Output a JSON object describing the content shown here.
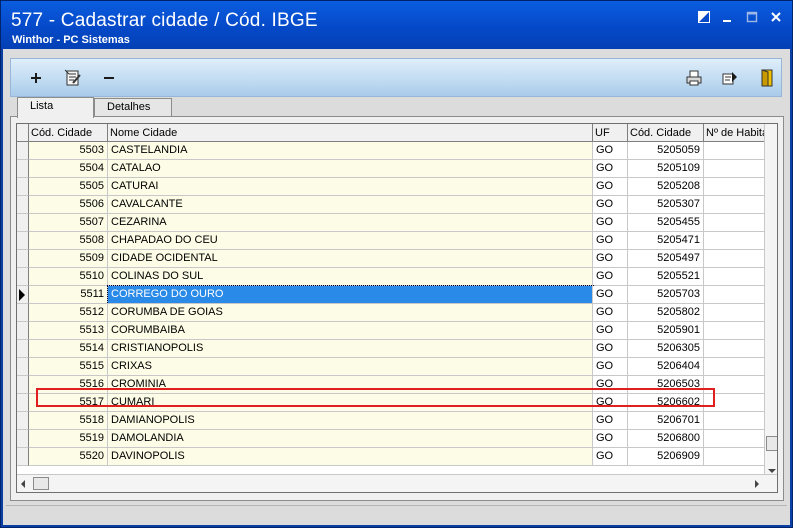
{
  "window": {
    "title": "577 - Cadastrar cidade / Cód. IBGE",
    "subtitle": "Winthor - PC Sistemas"
  },
  "toolbar": {
    "left_buttons": [
      "add-icon",
      "edit-document-icon",
      "remove-icon"
    ],
    "right_buttons": [
      "print-icon",
      "export-icon",
      "exit-icon"
    ]
  },
  "tabs": [
    {
      "label": "Lista",
      "active": true
    },
    {
      "label": "Detalhes",
      "active": false
    }
  ],
  "grid": {
    "columns": [
      "Cód. Cidade",
      "Nome Cidade",
      "UF",
      "Cód. Cidade",
      "Nº de Habita"
    ],
    "rows": [
      {
        "cod": "5503",
        "nome": "CASTELANDIA",
        "uf": "GO",
        "ibge": "5205059"
      },
      {
        "cod": "5504",
        "nome": "CATALAO",
        "uf": "GO",
        "ibge": "5205109"
      },
      {
        "cod": "5505",
        "nome": "CATURAI",
        "uf": "GO",
        "ibge": "5205208"
      },
      {
        "cod": "5506",
        "nome": "CAVALCANTE",
        "uf": "GO",
        "ibge": "5205307"
      },
      {
        "cod": "5507",
        "nome": "CEZARINA",
        "uf": "GO",
        "ibge": "5205455"
      },
      {
        "cod": "5508",
        "nome": "CHAPADAO DO CEU",
        "uf": "GO",
        "ibge": "5205471"
      },
      {
        "cod": "5509",
        "nome": "CIDADE OCIDENTAL",
        "uf": "GO",
        "ibge": "5205497"
      },
      {
        "cod": "5510",
        "nome": "COLINAS DO SUL",
        "uf": "GO",
        "ibge": "5205521"
      },
      {
        "cod": "5511",
        "nome": "CORREGO DO OURO",
        "uf": "GO",
        "ibge": "5205703"
      },
      {
        "cod": "5512",
        "nome": "CORUMBA DE GOIAS",
        "uf": "GO",
        "ibge": "5205802"
      },
      {
        "cod": "5513",
        "nome": "CORUMBAIBA",
        "uf": "GO",
        "ibge": "5205901"
      },
      {
        "cod": "5514",
        "nome": "CRISTIANOPOLIS",
        "uf": "GO",
        "ibge": "5206305"
      },
      {
        "cod": "5515",
        "nome": "CRIXAS",
        "uf": "GO",
        "ibge": "5206404"
      },
      {
        "cod": "5516",
        "nome": "CROMINIA",
        "uf": "GO",
        "ibge": "5206503"
      },
      {
        "cod": "5517",
        "nome": "CUMARI",
        "uf": "GO",
        "ibge": "5206602"
      },
      {
        "cod": "5518",
        "nome": "DAMIANOPOLIS",
        "uf": "GO",
        "ibge": "5206701"
      },
      {
        "cod": "5519",
        "nome": "DAMOLANDIA",
        "uf": "GO",
        "ibge": "5206800"
      },
      {
        "cod": "5520",
        "nome": "DAVINOPOLIS",
        "uf": "GO",
        "ibge": "5206909"
      }
    ],
    "selected_index": 8
  },
  "colors": {
    "titlebar": "#0549c8",
    "selection": "#2a8ae8",
    "highlight_border": "#e01f1f",
    "row_bg": "#fdfce6"
  }
}
